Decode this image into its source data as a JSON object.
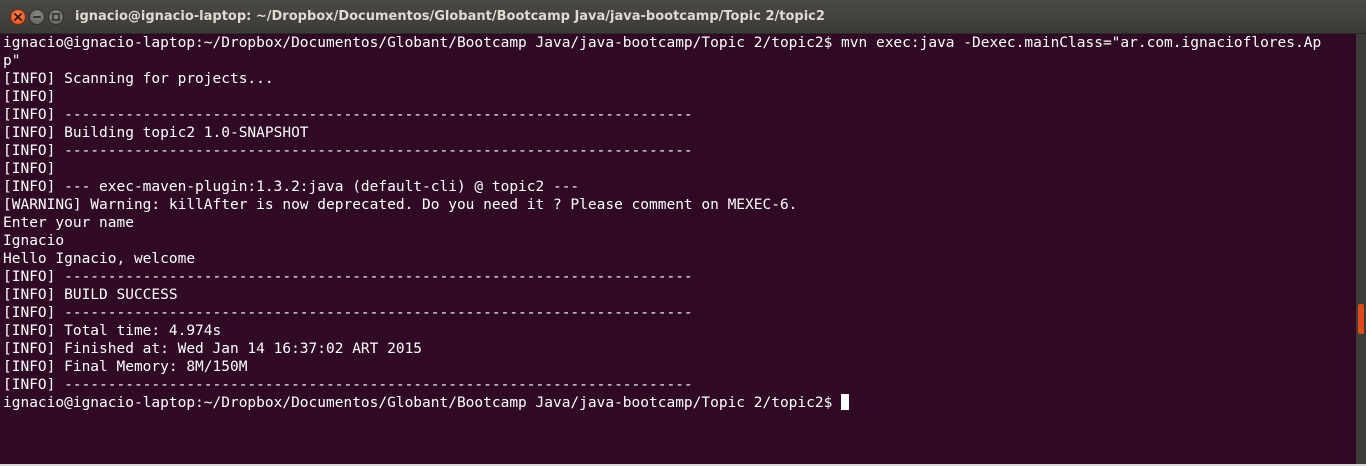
{
  "window": {
    "title": "ignacio@ignacio-laptop: ~/Dropbox/Documentos/Globant/Bootcamp Java/java-bootcamp/Topic 2/topic2",
    "controls": {
      "close_icon": "close-icon",
      "minimize_icon": "minimize-icon",
      "maximize_icon": "maximize-icon"
    }
  },
  "terminal": {
    "lines": [
      "ignacio@ignacio-laptop:~/Dropbox/Documentos/Globant/Bootcamp Java/java-bootcamp/Topic 2/topic2$ mvn exec:java -Dexec.mainClass=\"ar.com.ignacioflores.Ap",
      "p\"",
      "[INFO] Scanning for projects...",
      "[INFO]",
      "[INFO] ------------------------------------------------------------------------",
      "[INFO] Building topic2 1.0-SNAPSHOT",
      "[INFO] ------------------------------------------------------------------------",
      "[INFO]",
      "[INFO] --- exec-maven-plugin:1.3.2:java (default-cli) @ topic2 ---",
      "[WARNING] Warning: killAfter is now deprecated. Do you need it ? Please comment on MEXEC-6.",
      "Enter your name",
      "Ignacio",
      "Hello Ignacio, welcome",
      "[INFO] ------------------------------------------------------------------------",
      "[INFO] BUILD SUCCESS",
      "[INFO] ------------------------------------------------------------------------",
      "[INFO] Total time: 4.974s",
      "[INFO] Finished at: Wed Jan 14 16:37:02 ART 2015",
      "[INFO] Final Memory: 8M/150M",
      "[INFO] ------------------------------------------------------------------------"
    ],
    "prompt": "ignacio@ignacio-laptop:~/Dropbox/Documentos/Globant/Bootcamp Java/java-bootcamp/Topic 2/topic2$ ",
    "colors": {
      "background": "#300a24",
      "foreground": "#ffffff",
      "accent": "#df4a16"
    }
  }
}
